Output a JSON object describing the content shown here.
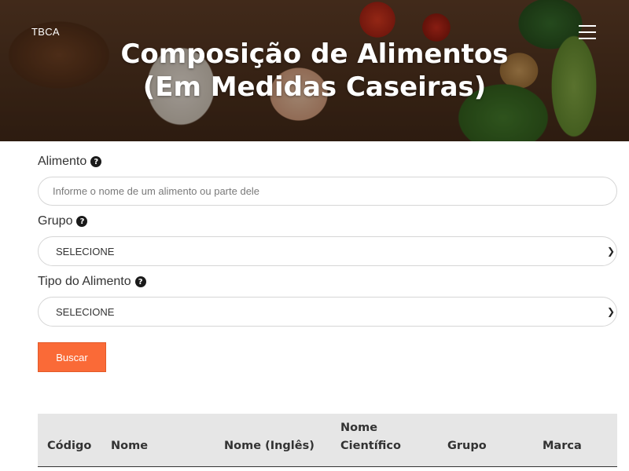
{
  "header": {
    "brand": "TBCA",
    "title_line1": "Composição de Alimentos",
    "title_line2": "(Em Medidas Caseiras)",
    "menu_icon": "hamburger-menu-icon"
  },
  "form": {
    "alimento": {
      "label": "Alimento",
      "placeholder": "Informe o nome de um alimento ou parte dele",
      "value": ""
    },
    "grupo": {
      "label": "Grupo",
      "selected": "SELECIONE"
    },
    "tipo": {
      "label": "Tipo do Alimento",
      "selected": "SELECIONE"
    },
    "help_icon": "question-circle-icon",
    "submit_label": "Buscar",
    "accent_color": "#fa6a37"
  },
  "table": {
    "columns": [
      "Código",
      "Nome",
      "Nome (Inglês)",
      "Nome Científico",
      "Grupo",
      "Marca"
    ],
    "header_bg": "#e6e6e6"
  }
}
